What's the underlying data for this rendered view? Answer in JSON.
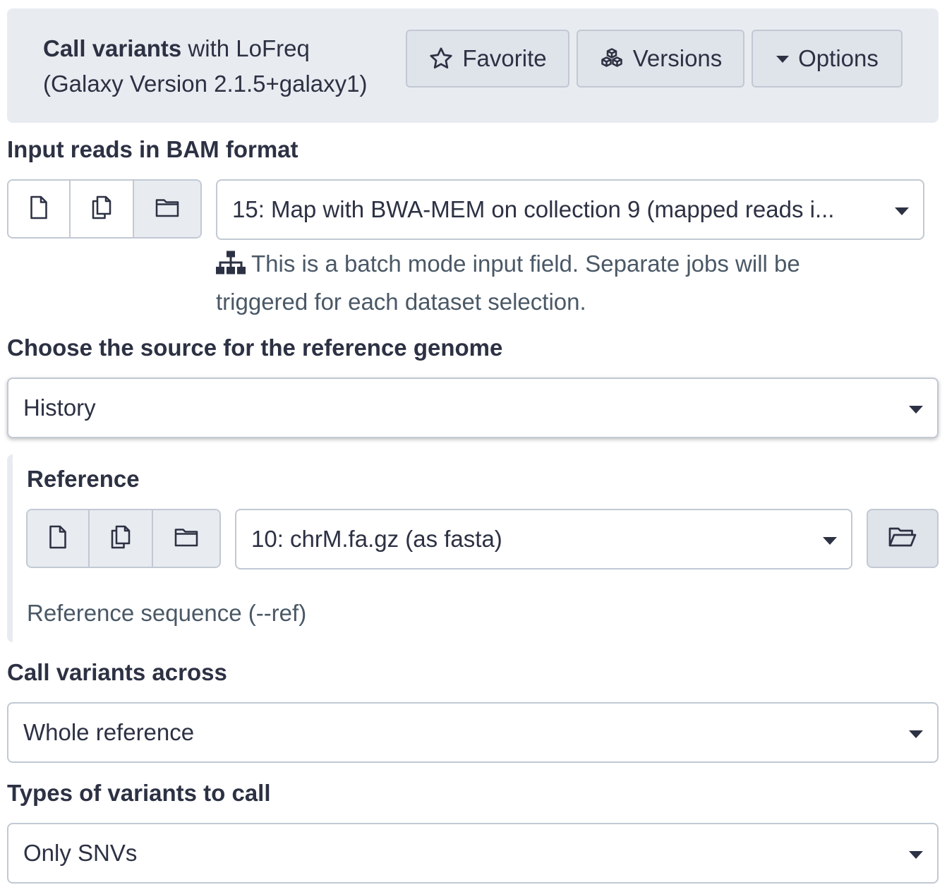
{
  "tool": {
    "name": "Call variants",
    "suffix": " with LoFreq",
    "version": "(Galaxy Version 2.1.5+galaxy1)"
  },
  "header_buttons": {
    "favorite": "Favorite",
    "versions": "Versions",
    "options": "Options"
  },
  "input_reads": {
    "label": "Input reads in BAM format",
    "value": "15: Map with BWA-MEM on collection 9 (mapped reads i...",
    "help": "This is a batch mode input field. Separate jobs will be triggered for each dataset selection."
  },
  "genome_source": {
    "label": "Choose the source for the reference genome",
    "value": "History"
  },
  "reference": {
    "label": "Reference",
    "value": "10: chrM.fa.gz (as fasta)",
    "help": "Reference sequence (--ref)"
  },
  "call_across": {
    "label": "Call variants across",
    "value": "Whole reference"
  },
  "variant_types": {
    "label": "Types of variants to call",
    "value": "Only SNVs"
  },
  "icons": {
    "favorite": "star-icon",
    "versions": "cubes-icon",
    "options": "caret-down-icon",
    "single": "file-icon",
    "multiple": "files-icon",
    "collection": "folder-icon",
    "batch": "sitemap-icon",
    "browse": "folder-open-icon"
  },
  "colors": {
    "header_bg": "#e8ebf0",
    "border": "#c2c9d4",
    "text": "#2c3143"
  }
}
